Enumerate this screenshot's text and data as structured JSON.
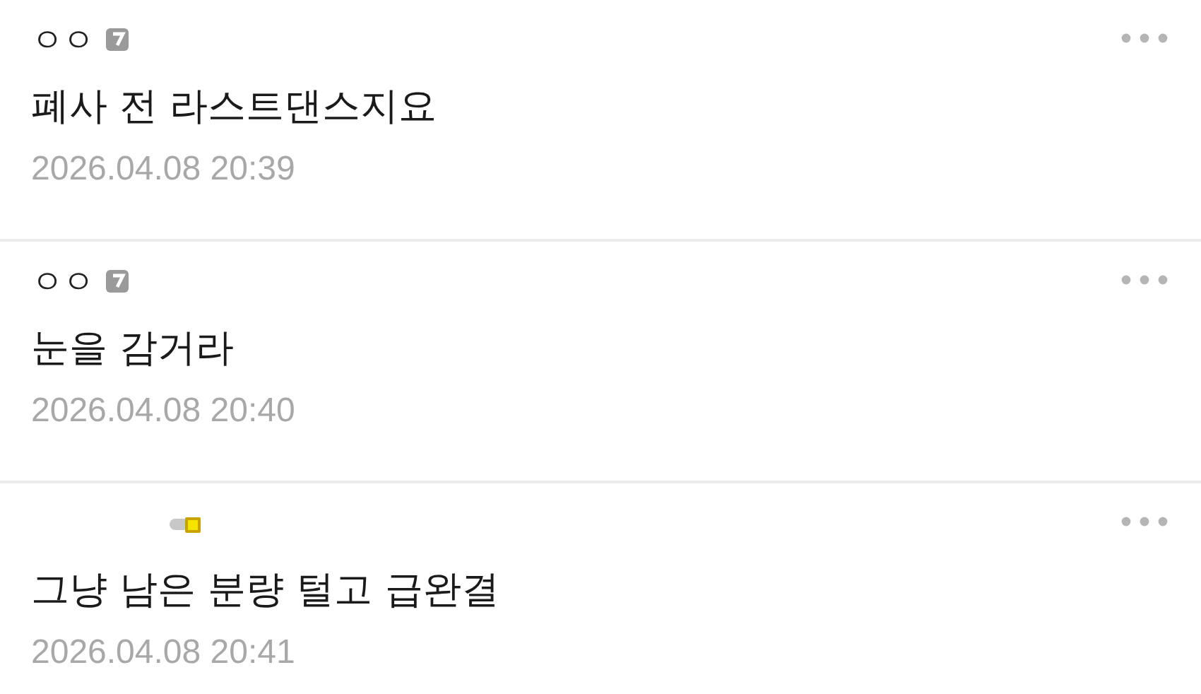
{
  "comments": [
    {
      "author": "ㅇㅇ",
      "kind": "member",
      "text": "폐사 전 라스트댄스지요",
      "date": "2026.04.08 20:39"
    },
    {
      "author": "ㅇㅇ",
      "kind": "member",
      "text": "눈을 감거라",
      "date": "2026.04.08 20:40"
    },
    {
      "kind": "fixed",
      "text": "그냥 남은 분량 털고 급완결",
      "date": "2026.04.08 20:41"
    }
  ]
}
